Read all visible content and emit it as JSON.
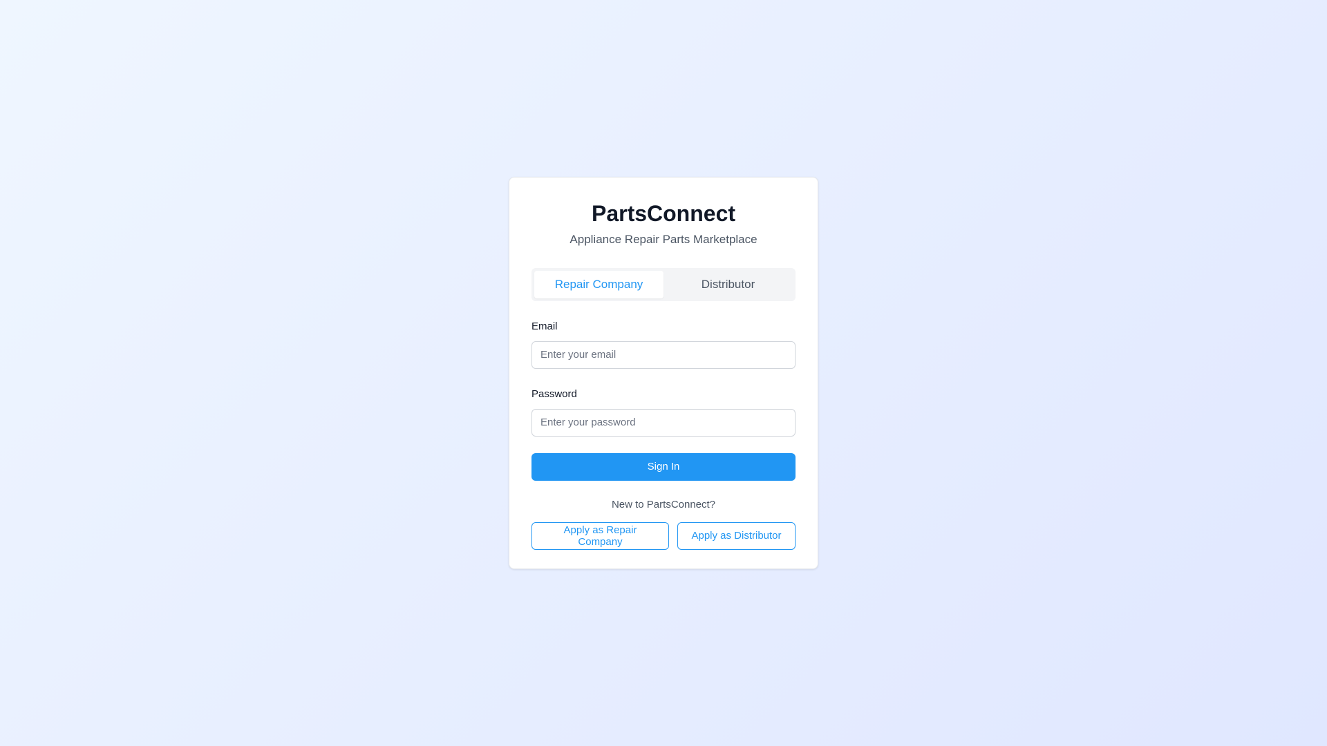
{
  "brand": {
    "title": "PartsConnect",
    "subtitle": "Appliance Repair Parts Marketplace"
  },
  "role_tabs": [
    {
      "label": "Repair Company",
      "active": true
    },
    {
      "label": "Distributor",
      "active": false
    }
  ],
  "form": {
    "email": {
      "label": "Email",
      "value": "",
      "placeholder": "Enter your email"
    },
    "password": {
      "label": "Password",
      "value": "",
      "placeholder": "Enter your password"
    },
    "submit_label": "Sign In"
  },
  "register": {
    "prompt": "New to PartsConnect?",
    "apply_repair_label": "Apply as Repair Company",
    "apply_distributor_label": "Apply as Distributor"
  },
  "colors": {
    "accent": "#2196f3",
    "background_start": "#eff6ff",
    "background_end": "#e0e7ff",
    "card": "#ffffff"
  }
}
